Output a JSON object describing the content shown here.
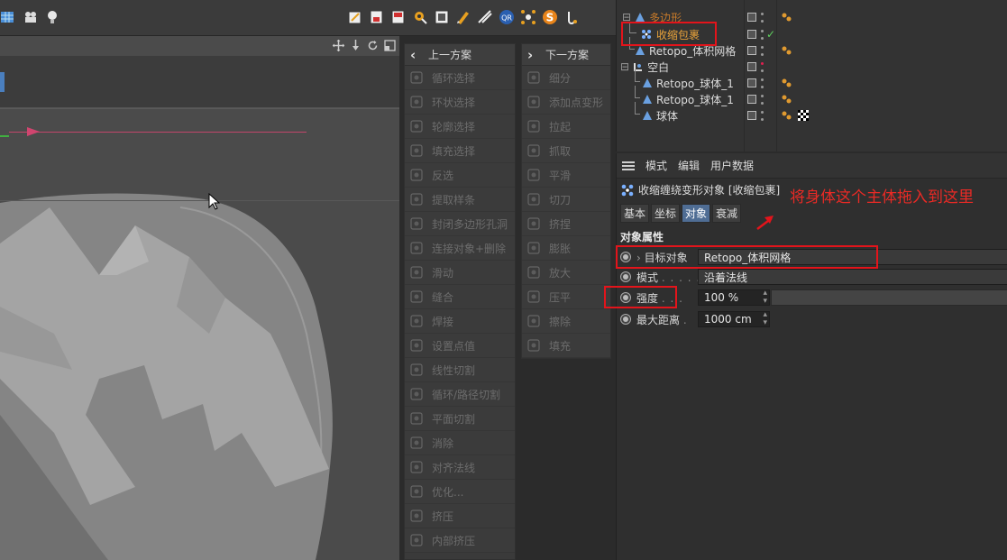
{
  "toolbar": {
    "left_icons": [
      "layout-icon",
      "film-icon",
      "light-icon"
    ],
    "right_icons": [
      "render-region-icon",
      "render-view-icon",
      "render-icon",
      "render-settings-icon",
      "picture-viewer-icon",
      "brush-icon",
      "knife-icon",
      "qr-plugin-icon",
      "explode-icon",
      "s-plugin-icon",
      "timer-icon"
    ],
    "qr_label": "QR",
    "s_label": "S"
  },
  "viewport": {
    "nav_icons": [
      "move-view-icon",
      "pan-view-icon",
      "rotate-view-icon",
      "maximize-view-icon"
    ]
  },
  "command_left": {
    "header": "上一方案",
    "items": [
      "循环选择",
      "环状选择",
      "轮廓选择",
      "填充选择",
      "反选",
      "提取样条",
      "封闭多边形孔洞",
      "连接对象+删除",
      "滑动",
      "缝合",
      "焊接",
      "设置点值",
      "线性切割",
      "循环/路径切割",
      "平面切割",
      "消除",
      "对齐法线",
      "优化...",
      "挤压",
      "内部挤压"
    ]
  },
  "command_right": {
    "header": "下一方案",
    "items": [
      "细分",
      "添加点变形",
      "拉起",
      "抓取",
      "平滑",
      "切刀",
      "挤捏",
      "膨胀",
      "放大",
      "压平",
      "擦除",
      "填充"
    ]
  },
  "object_manager": {
    "rows": [
      {
        "name": "多边形",
        "color": "dim"
      },
      {
        "name": "收缩包裹",
        "color": "orange"
      },
      {
        "name": "Retopo_体积网格",
        "color": "normal"
      },
      {
        "name": "空白",
        "color": "normal"
      },
      {
        "name": "Retopo_球体_1",
        "color": "normal"
      },
      {
        "name": "Retopo_球体_1",
        "color": "normal"
      },
      {
        "name": "球体",
        "color": "normal"
      }
    ],
    "check_mark": "✓"
  },
  "attributes": {
    "menu": [
      "模式",
      "编辑",
      "用户数据"
    ],
    "object_title": "收缩缠绕变形对象 [收缩包裹]",
    "tabs": [
      "基本",
      "坐标",
      "对象",
      "衰减"
    ],
    "active_tab": "对象",
    "section": "对象属性",
    "fields": {
      "target": {
        "label": "目标对象",
        "value": "Retopo_体积网格"
      },
      "mode": {
        "label": "模式",
        "dots": ". . . . .",
        "value": "沿着法线"
      },
      "strength": {
        "label": "强度",
        "dots": ". . .",
        "value": "100 %",
        "level_percent": 100
      },
      "max_distance": {
        "label": "最大距离",
        "dots": ".",
        "value": "1000 cm"
      }
    }
  },
  "annotation": {
    "note": "将身体这个主体拖入到这里",
    "color": "#e3141b"
  }
}
